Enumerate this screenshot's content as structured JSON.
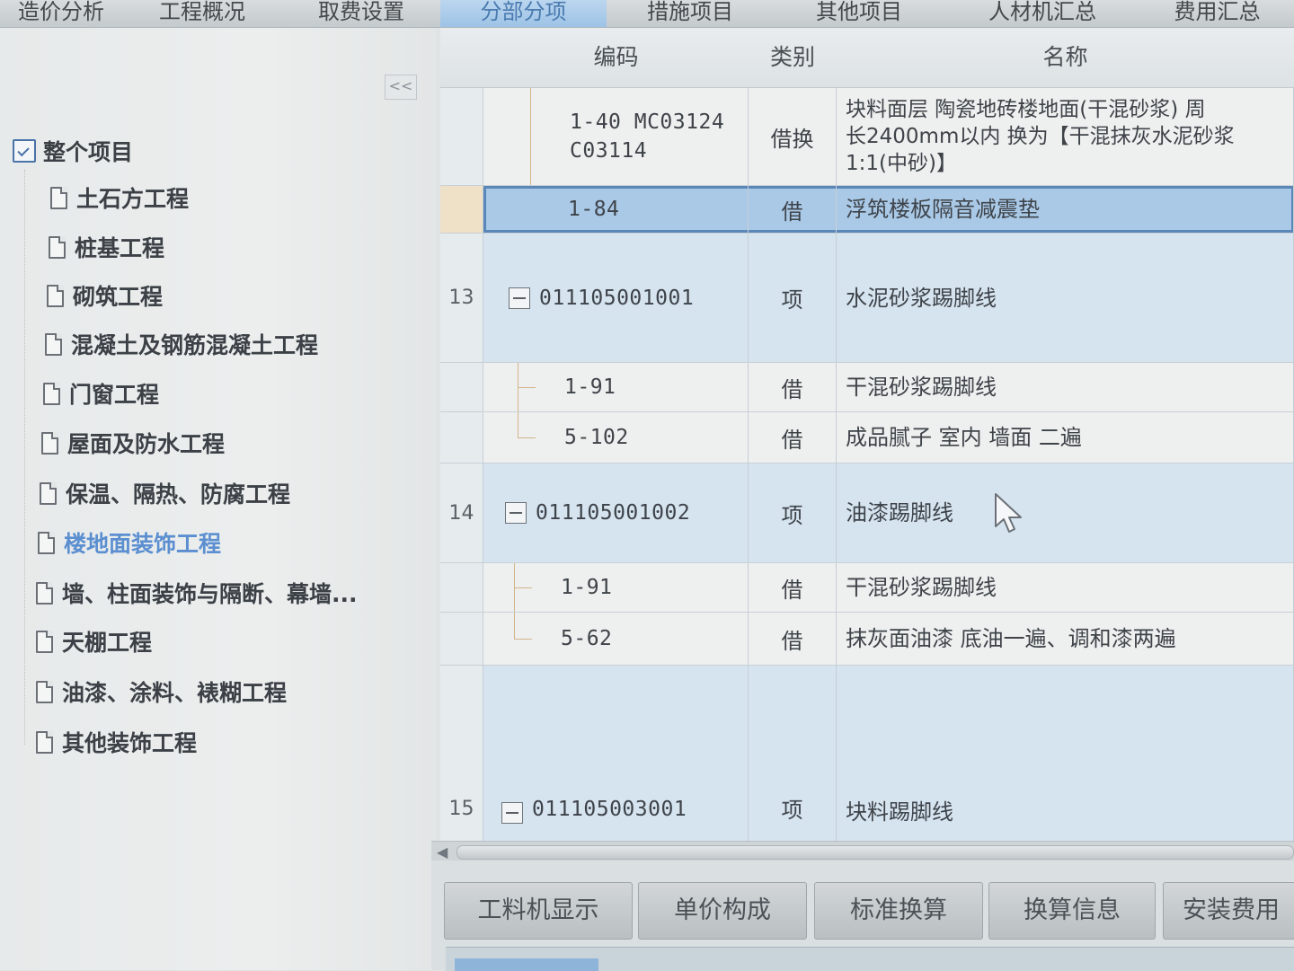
{
  "top_tabs": [
    "造价分析",
    "工程概况",
    "取费设置",
    "分部分项",
    "措施项目",
    "其他项目",
    "人材机汇总",
    "费用汇总"
  ],
  "collapse_label": "<<",
  "tree": {
    "root": "整个项目",
    "items": [
      {
        "label": "土石方工程"
      },
      {
        "label": "桩基工程"
      },
      {
        "label": "砌筑工程"
      },
      {
        "label": "混凝土及钢筋混凝土工程"
      },
      {
        "label": "门窗工程"
      },
      {
        "label": "屋面及防水工程"
      },
      {
        "label": "保温、隔热、防腐工程"
      },
      {
        "label": "楼地面装饰工程",
        "selected": true
      },
      {
        "label": "墙、柱面装饰与隔断、幕墙..."
      },
      {
        "label": "天棚工程"
      },
      {
        "label": "油漆、涂料、裱糊工程"
      },
      {
        "label": "其他装饰工程"
      }
    ]
  },
  "grid": {
    "headers": {
      "code": "编码",
      "type": "类别",
      "name": "名称"
    },
    "rows": [
      {
        "idx": "",
        "code": "1-40 MC03124\nC03114",
        "type": "借换",
        "name": "块料面层 陶瓷地砖楼地面(干混砂浆) 周\n长2400mm以内  换为【干混抹灰水泥砂浆\n1:1(中砂)】",
        "level": "child"
      },
      {
        "idx": "",
        "code": "1-84",
        "type": "借",
        "name": "浮筑楼板隔音减震垫",
        "level": "child",
        "selected": true
      },
      {
        "idx": "13",
        "code": "011105001001",
        "type": "项",
        "name": "水泥砂浆踢脚线",
        "level": "parent"
      },
      {
        "idx": "",
        "code": "1-91",
        "type": "借",
        "name": "干混砂浆踢脚线",
        "level": "child"
      },
      {
        "idx": "",
        "code": "5-102",
        "type": "借",
        "name": "成品腻子 室内 墙面 二遍",
        "level": "child"
      },
      {
        "idx": "14",
        "code": "011105001002",
        "type": "项",
        "name": "油漆踢脚线",
        "level": "parent"
      },
      {
        "idx": "",
        "code": "1-91",
        "type": "借",
        "name": "干混砂浆踢脚线",
        "level": "child"
      },
      {
        "idx": "",
        "code": "5-62",
        "type": "借",
        "name": "抹灰面油漆 底油一遍、调和漆两遍",
        "level": "child"
      },
      {
        "idx": "15",
        "code": "011105003001",
        "type": "项",
        "name": "块料踢脚线",
        "level": "parent"
      }
    ]
  },
  "bottom_tabs": [
    "工料机显示",
    "单价构成",
    "标准换算",
    "换算信息",
    "安装费用"
  ],
  "colors": {
    "accent": "#5a86b8",
    "selected_row": "#a9c9e7",
    "parent_row": "#d6e4f0"
  }
}
